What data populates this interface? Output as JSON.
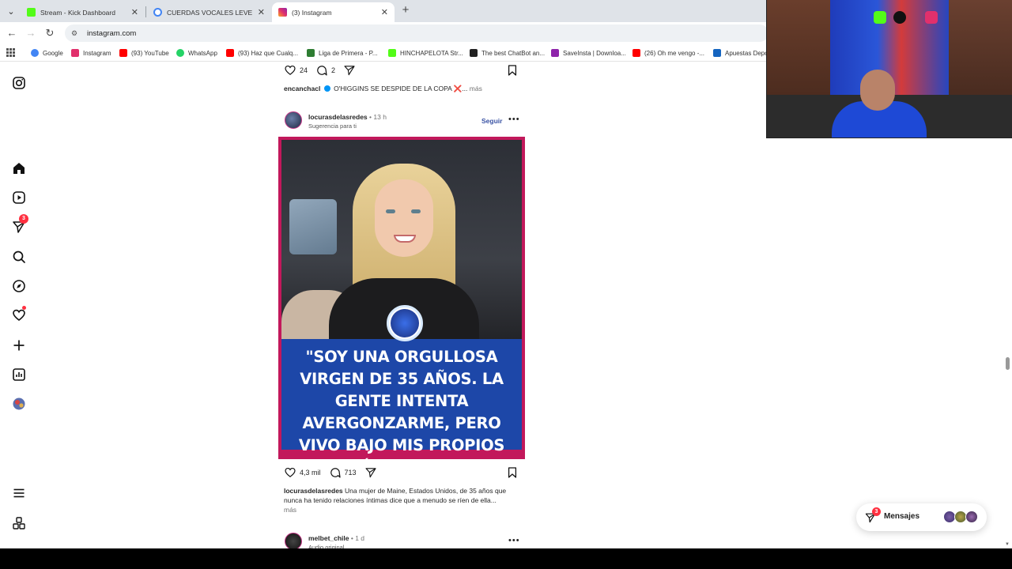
{
  "browser": {
    "tabs": [
      {
        "label": "Stream - Kick Dashboard",
        "favicon_color": "#53fc18"
      },
      {
        "label": "CUERDAS VOCALES LEVE ERITE",
        "favicon_color": "#4285f4"
      },
      {
        "label": "(3) Instagram",
        "favicon_color": "#e1306c"
      }
    ],
    "url": "instagram.com",
    "bookmarks": [
      {
        "label": "Google",
        "color": "#4285f4"
      },
      {
        "label": "Instagram",
        "color": "#e1306c"
      },
      {
        "label": "(93) YouTube",
        "color": "#ff0000"
      },
      {
        "label": "WhatsApp",
        "color": "#25d366"
      },
      {
        "label": "(93) Haz que Cualq...",
        "color": "#ff0000"
      },
      {
        "label": "Liga de Primera - P...",
        "color": "#2e7d32"
      },
      {
        "label": "HINCHAPELOTA Str...",
        "color": "#53fc18"
      },
      {
        "label": "The best ChatBot an...",
        "color": "#222222"
      },
      {
        "label": "SaveInsta | Downloa...",
        "color": "#8e24aa"
      },
      {
        "label": "(26) Oh me vengo -...",
        "color": "#ff0000"
      },
      {
        "label": "Apuestas Depo",
        "color": "#1565c0"
      }
    ]
  },
  "sidebar": {
    "badges": {
      "notifications": "3"
    }
  },
  "feed": {
    "prev_post": {
      "likes": "24",
      "comments": "2",
      "username": "encanchacl",
      "caption": "O'HIGGINS SE DESPIDE DE LA COPA ❌...",
      "more": "más"
    },
    "post": {
      "username": "locurasdelasredes",
      "time": "13 h",
      "subtitle": "Sugerencia para ti",
      "follow": "Seguir",
      "quote": "\"SOY UNA ORGULLOSA VIRGEN DE 35 AÑOS. LA GENTE INTENTA AVERGONZARME, PERO VIVO BAJO MIS PROPIOS TÉRMINOS\".",
      "likes": "4,3 mil",
      "comments": "713",
      "caption": "Una mujer de Maine, Estados Unidos, de 35 años que nunca ha tenido relaciones íntimas dice que a menudo se ríen de ella...",
      "more": "más"
    },
    "next_post": {
      "username": "melbet_chile",
      "time": "1 d",
      "subtitle": "Audio original"
    }
  },
  "messages": {
    "label": "Mensajes",
    "badge": "3"
  },
  "colors": {
    "instagram_pink": "#c2185b",
    "quote_band": "#1d47a8",
    "notification_red": "#ff3040"
  }
}
